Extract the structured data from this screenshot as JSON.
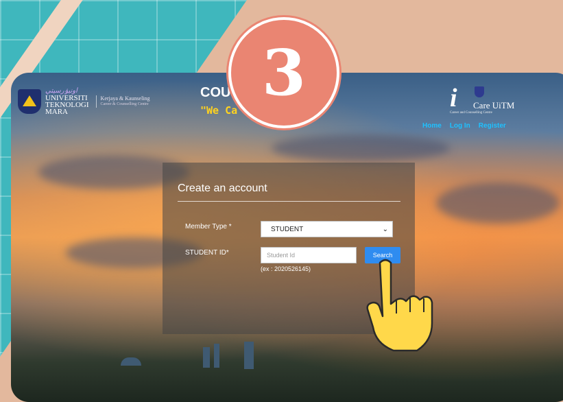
{
  "badge": {
    "number": "3"
  },
  "header": {
    "uni_script": "اونيۏرسيتي",
    "uni_line1": "UNIVERSITI",
    "uni_line2": "TEKNOLOGI",
    "uni_line3": "MARA",
    "unit_name": "Kerjaya & Kaunseling",
    "unit_sub": "Career & Counselling Centre",
    "site_title": "COU",
    "slogan": "\"We Ca",
    "brand_name": "Care UiTM",
    "brand_i": "i",
    "brand_sub": "Career and Counselling Centre"
  },
  "nav": {
    "home": "Home",
    "login": "Log In",
    "register": "Register"
  },
  "form": {
    "title": "Create an account",
    "member_type_label": "Member Type *",
    "member_type_value": "STUDENT",
    "student_id_label": "STUDENT ID*",
    "student_id_placeholder": "Student Id",
    "search_label": "Search",
    "hint": "(ex : 2020526145)"
  },
  "colors": {
    "teal": "#3fb7bd",
    "peach": "#e3b89d",
    "badge": "#ea8572",
    "button_blue": "#2f8cf0",
    "nav_link": "#1ec1ff",
    "hand_yellow": "#ffd84a"
  }
}
